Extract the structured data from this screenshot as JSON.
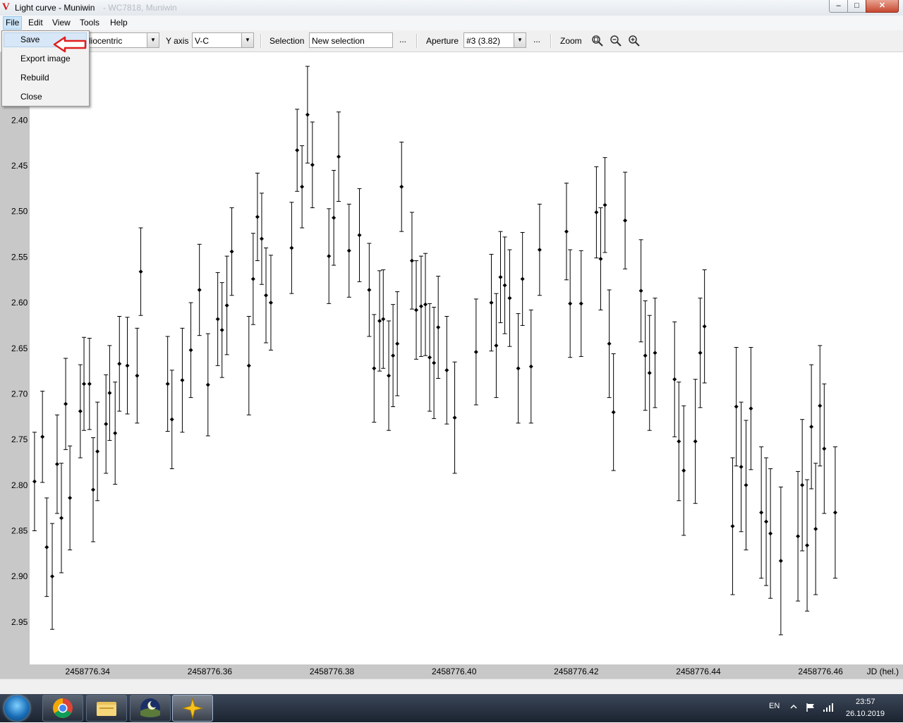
{
  "window": {
    "title": "Light curve - Muniwin",
    "title_blurred": "- WC7818, Muniwin",
    "controls": {
      "minimize": "‒",
      "maximize": "□",
      "close": "✕"
    }
  },
  "menubar": {
    "items": [
      {
        "label": "File",
        "accel": "F"
      },
      {
        "label": "Edit",
        "accel": "E"
      },
      {
        "label": "View",
        "accel": "V"
      },
      {
        "label": "Tools",
        "accel": "T"
      },
      {
        "label": "Help",
        "accel": "H"
      }
    ]
  },
  "file_menu": {
    "items": [
      "Save",
      "Export image",
      "Rebuild",
      "Close"
    ],
    "selected": "Save"
  },
  "toolbar": {
    "x_axis_value": "liocentric",
    "y_axis_label": "Y axis",
    "y_axis_value": "V-C",
    "selection_label": "Selection",
    "selection_value": "New selection",
    "selection_more": "...",
    "aperture_label": "Aperture",
    "aperture_value": "#3 (3.82)",
    "aperture_more": "...",
    "zoom_label": "Zoom",
    "zoom_icons": [
      "zoom-fit-icon",
      "zoom-out-icon",
      "zoom-in-icon"
    ]
  },
  "chart_data": {
    "type": "scatter",
    "xlabel": "JD (hel.)",
    "ylabel": "",
    "y_inverted": true,
    "xlim": [
      2458776.3305,
      2458776.4735
    ],
    "ylim": [
      2.3255,
      2.9965
    ],
    "x_ticks": [
      "2458776.34",
      "2458776.36",
      "2458776.38",
      "2458776.40",
      "2458776.42",
      "2458776.44",
      "2458776.46"
    ],
    "y_ticks": [
      "2.40",
      "2.45",
      "2.50",
      "2.55",
      "2.60",
      "2.65",
      "2.70",
      "2.75",
      "2.80",
      "2.85",
      "2.90",
      "2.95"
    ],
    "error_bars": true,
    "points": [
      {
        "x": 2458776.3313,
        "y": 2.796,
        "err": 0.054
      },
      {
        "x": 2458776.3326,
        "y": 2.747,
        "err": 0.05
      },
      {
        "x": 2458776.3333,
        "y": 2.868,
        "err": 0.054
      },
      {
        "x": 2458776.3342,
        "y": 2.9,
        "err": 0.058
      },
      {
        "x": 2458776.335,
        "y": 2.777,
        "err": 0.054
      },
      {
        "x": 2458776.3357,
        "y": 2.836,
        "err": 0.06
      },
      {
        "x": 2458776.3364,
        "y": 2.711,
        "err": 0.05
      },
      {
        "x": 2458776.3371,
        "y": 2.814,
        "err": 0.057
      },
      {
        "x": 2458776.3388,
        "y": 2.719,
        "err": 0.051
      },
      {
        "x": 2458776.3394,
        "y": 2.689,
        "err": 0.051
      },
      {
        "x": 2458776.3403,
        "y": 2.689,
        "err": 0.05
      },
      {
        "x": 2458776.3409,
        "y": 2.805,
        "err": 0.057
      },
      {
        "x": 2458776.3416,
        "y": 2.763,
        "err": 0.054
      },
      {
        "x": 2458776.343,
        "y": 2.733,
        "err": 0.054
      },
      {
        "x": 2458776.3436,
        "y": 2.699,
        "err": 0.052
      },
      {
        "x": 2458776.3445,
        "y": 2.743,
        "err": 0.056
      },
      {
        "x": 2458776.3452,
        "y": 2.667,
        "err": 0.052
      },
      {
        "x": 2458776.3465,
        "y": 2.669,
        "err": 0.053
      },
      {
        "x": 2458776.3481,
        "y": 2.68,
        "err": 0.052
      },
      {
        "x": 2458776.3487,
        "y": 2.566,
        "err": 0.048
      },
      {
        "x": 2458776.3531,
        "y": 2.689,
        "err": 0.052
      },
      {
        "x": 2458776.3538,
        "y": 2.728,
        "err": 0.054
      },
      {
        "x": 2458776.3555,
        "y": 2.685,
        "err": 0.057
      },
      {
        "x": 2458776.3569,
        "y": 2.652,
        "err": 0.052
      },
      {
        "x": 2458776.3583,
        "y": 2.586,
        "err": 0.05
      },
      {
        "x": 2458776.3597,
        "y": 2.69,
        "err": 0.056
      },
      {
        "x": 2458776.3613,
        "y": 2.618,
        "err": 0.051
      },
      {
        "x": 2458776.362,
        "y": 2.63,
        "err": 0.052
      },
      {
        "x": 2458776.3628,
        "y": 2.603,
        "err": 0.054
      },
      {
        "x": 2458776.3636,
        "y": 2.544,
        "err": 0.048
      },
      {
        "x": 2458776.3664,
        "y": 2.669,
        "err": 0.054
      },
      {
        "x": 2458776.3671,
        "y": 2.574,
        "err": 0.05
      },
      {
        "x": 2458776.3678,
        "y": 2.506,
        "err": 0.048
      },
      {
        "x": 2458776.3685,
        "y": 2.53,
        "err": 0.05
      },
      {
        "x": 2458776.3692,
        "y": 2.592,
        "err": 0.052
      },
      {
        "x": 2458776.37,
        "y": 2.6,
        "err": 0.052
      },
      {
        "x": 2458776.3734,
        "y": 2.54,
        "err": 0.05
      },
      {
        "x": 2458776.3743,
        "y": 2.433,
        "err": 0.045
      },
      {
        "x": 2458776.3751,
        "y": 2.473,
        "err": 0.045
      },
      {
        "x": 2458776.376,
        "y": 2.394,
        "err": 0.053
      },
      {
        "x": 2458776.3768,
        "y": 2.449,
        "err": 0.047
      },
      {
        "x": 2458776.3795,
        "y": 2.549,
        "err": 0.052
      },
      {
        "x": 2458776.3803,
        "y": 2.507,
        "err": 0.052
      },
      {
        "x": 2458776.3811,
        "y": 2.44,
        "err": 0.049
      },
      {
        "x": 2458776.3828,
        "y": 2.543,
        "err": 0.051
      },
      {
        "x": 2458776.3845,
        "y": 2.526,
        "err": 0.051
      },
      {
        "x": 2458776.3861,
        "y": 2.586,
        "err": 0.051
      },
      {
        "x": 2458776.3869,
        "y": 2.672,
        "err": 0.059
      },
      {
        "x": 2458776.3878,
        "y": 2.62,
        "err": 0.055
      },
      {
        "x": 2458776.3884,
        "y": 2.618,
        "err": 0.054
      },
      {
        "x": 2458776.3893,
        "y": 2.68,
        "err": 0.06
      },
      {
        "x": 2458776.39,
        "y": 2.658,
        "err": 0.056
      },
      {
        "x": 2458776.3907,
        "y": 2.645,
        "err": 0.057
      },
      {
        "x": 2458776.3914,
        "y": 2.473,
        "err": 0.049
      },
      {
        "x": 2458776.3931,
        "y": 2.554,
        "err": 0.053
      },
      {
        "x": 2458776.3938,
        "y": 2.608,
        "err": 0.054
      },
      {
        "x": 2458776.3946,
        "y": 2.604,
        "err": 0.055
      },
      {
        "x": 2458776.3953,
        "y": 2.602,
        "err": 0.056
      },
      {
        "x": 2458776.396,
        "y": 2.66,
        "err": 0.059
      },
      {
        "x": 2458776.3967,
        "y": 2.666,
        "err": 0.061
      },
      {
        "x": 2458776.3974,
        "y": 2.627,
        "err": 0.056
      },
      {
        "x": 2458776.3988,
        "y": 2.674,
        "err": 0.059
      },
      {
        "x": 2458776.4001,
        "y": 2.726,
        "err": 0.061
      },
      {
        "x": 2458776.4036,
        "y": 2.654,
        "err": 0.058
      },
      {
        "x": 2458776.4061,
        "y": 2.6,
        "err": 0.053
      },
      {
        "x": 2458776.4069,
        "y": 2.647,
        "err": 0.057
      },
      {
        "x": 2458776.4076,
        "y": 2.572,
        "err": 0.05
      },
      {
        "x": 2458776.4083,
        "y": 2.581,
        "err": 0.053
      },
      {
        "x": 2458776.4091,
        "y": 2.595,
        "err": 0.053
      },
      {
        "x": 2458776.4105,
        "y": 2.672,
        "err": 0.06
      },
      {
        "x": 2458776.4112,
        "y": 2.574,
        "err": 0.051
      },
      {
        "x": 2458776.4126,
        "y": 2.67,
        "err": 0.062
      },
      {
        "x": 2458776.414,
        "y": 2.542,
        "err": 0.05
      },
      {
        "x": 2458776.4184,
        "y": 2.522,
        "err": 0.053
      },
      {
        "x": 2458776.419,
        "y": 2.601,
        "err": 0.059
      },
      {
        "x": 2458776.4208,
        "y": 2.601,
        "err": 0.058
      },
      {
        "x": 2458776.4233,
        "y": 2.501,
        "err": 0.05
      },
      {
        "x": 2458776.424,
        "y": 2.552,
        "err": 0.056
      },
      {
        "x": 2458776.4247,
        "y": 2.493,
        "err": 0.052
      },
      {
        "x": 2458776.4254,
        "y": 2.645,
        "err": 0.059
      },
      {
        "x": 2458776.4261,
        "y": 2.72,
        "err": 0.064
      },
      {
        "x": 2458776.428,
        "y": 2.51,
        "err": 0.053
      },
      {
        "x": 2458776.4306,
        "y": 2.587,
        "err": 0.056
      },
      {
        "x": 2458776.4313,
        "y": 2.658,
        "err": 0.06
      },
      {
        "x": 2458776.432,
        "y": 2.677,
        "err": 0.063
      },
      {
        "x": 2458776.4329,
        "y": 2.655,
        "err": 0.06
      },
      {
        "x": 2458776.4361,
        "y": 2.684,
        "err": 0.063
      },
      {
        "x": 2458776.4368,
        "y": 2.752,
        "err": 0.065
      },
      {
        "x": 2458776.4376,
        "y": 2.784,
        "err": 0.071
      },
      {
        "x": 2458776.4395,
        "y": 2.752,
        "err": 0.068
      },
      {
        "x": 2458776.4403,
        "y": 2.655,
        "err": 0.06
      },
      {
        "x": 2458776.441,
        "y": 2.626,
        "err": 0.062
      },
      {
        "x": 2458776.4456,
        "y": 2.845,
        "err": 0.075
      },
      {
        "x": 2458776.4462,
        "y": 2.714,
        "err": 0.065
      },
      {
        "x": 2458776.447,
        "y": 2.78,
        "err": 0.071
      },
      {
        "x": 2458776.4478,
        "y": 2.8,
        "err": 0.071
      },
      {
        "x": 2458776.4486,
        "y": 2.716,
        "err": 0.067
      },
      {
        "x": 2458776.4503,
        "y": 2.83,
        "err": 0.072
      },
      {
        "x": 2458776.4511,
        "y": 2.84,
        "err": 0.07
      },
      {
        "x": 2458776.4518,
        "y": 2.853,
        "err": 0.071
      },
      {
        "x": 2458776.4535,
        "y": 2.883,
        "err": 0.081
      },
      {
        "x": 2458776.4563,
        "y": 2.856,
        "err": 0.071
      },
      {
        "x": 2458776.457,
        "y": 2.8,
        "err": 0.072
      },
      {
        "x": 2458776.4578,
        "y": 2.866,
        "err": 0.072
      },
      {
        "x": 2458776.4585,
        "y": 2.736,
        "err": 0.068
      },
      {
        "x": 2458776.4592,
        "y": 2.848,
        "err": 0.072
      },
      {
        "x": 2458776.4599,
        "y": 2.713,
        "err": 0.066
      },
      {
        "x": 2458776.4606,
        "y": 2.76,
        "err": 0.071
      },
      {
        "x": 2458776.4624,
        "y": 2.83,
        "err": 0.072
      }
    ]
  },
  "taskbar": {
    "apps": [
      "start-orb",
      "chrome-icon",
      "explorer-icon",
      "stellarium-icon",
      "muniwin-icon"
    ],
    "language": "EN",
    "time": "23:57",
    "date": "26.10.2019"
  }
}
